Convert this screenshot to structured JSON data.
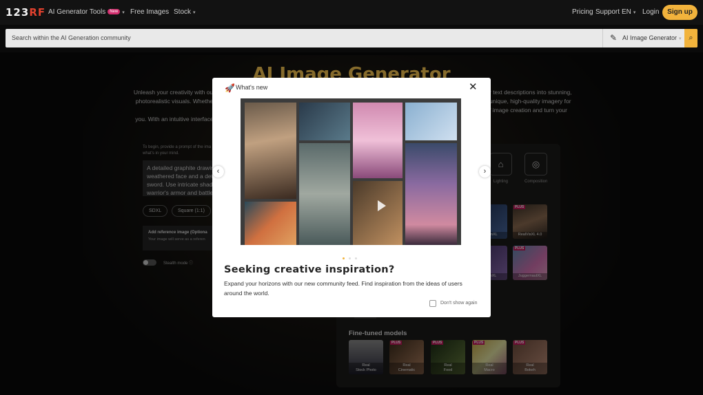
{
  "header": {
    "logo_main": "123",
    "logo_accent": "RF",
    "nav": [
      {
        "label": "AI Generator Tools",
        "badge": "New"
      },
      {
        "label": "Free Images"
      },
      {
        "label": "Stock"
      }
    ],
    "right_nav": {
      "pricing": "Pricing",
      "support": "Support",
      "language": "EN",
      "login": "Login",
      "signup": "Sign up"
    }
  },
  "search": {
    "placeholder": "Search within the AI Generation community",
    "scope": "AI Image Generator"
  },
  "hero": {
    "title": "AI Image Generator",
    "left_lines": [
      "Unleash your creativity with our",
      "photorealistic visuals. Whether y",
      "you. With an intuitive interface,"
    ],
    "right_lines": [
      "r text descriptions into stunning,",
      "unique, high-quality imagery for",
      "f image creation and turn your"
    ]
  },
  "left_panel": {
    "instructions": "To begin, provide a prompt of the ima what's in your mind.",
    "prompt_text": "A detailed graphite drawin weathered face and a det sword. Use intricate shadi warrior's armor and battle",
    "chips": [
      "SDXL",
      "Square (1:1)"
    ],
    "ref_title": "Add reference image (Optiona",
    "ref_desc": "Your image will serve as a referen",
    "stealth": "Stealth mode"
  },
  "right_panel": {
    "options": [
      {
        "label": "Lighting",
        "icon": "lighting-icon"
      },
      {
        "label": "Composition",
        "icon": "composition-icon"
      }
    ],
    "models": [
      {
        "label": "...sionXL",
        "plus": ""
      },
      {
        "label": "RealVisXL 4.0",
        "plus": "PLUS"
      },
      {
        "label": "...ionXL",
        "plus": ""
      },
      {
        "label": "JuggernautXL",
        "plus": "PLUS"
      }
    ],
    "sdxl_tag": "DALL·E 3",
    "finetuned_title": "Fine-tuned models",
    "finetuned": [
      {
        "line1": "Real",
        "line2": "Stock Photo",
        "plus": ""
      },
      {
        "line1": "Real",
        "line2": "Cinematic",
        "plus": "PLUS"
      },
      {
        "line1": "Real",
        "line2": "Food",
        "plus": "PLUS"
      },
      {
        "line1": "Real",
        "line2": "Macro",
        "plus": "PLUS"
      },
      {
        "line1": "Real",
        "line2": "Bokeh",
        "plus": "PLUS"
      }
    ]
  },
  "modal": {
    "header": "What's new",
    "title": "Seeking creative inspiration?",
    "description": "Expand your horizons with our new community feed. Find inspiration from the ideas of users around the world.",
    "dont_show": "Don't show again",
    "active_dot": 0,
    "dot_count": 3
  },
  "colors": {
    "accent": "#f2b33c",
    "brand_red": "#e0412e",
    "plus_badge": "#c2185b"
  }
}
